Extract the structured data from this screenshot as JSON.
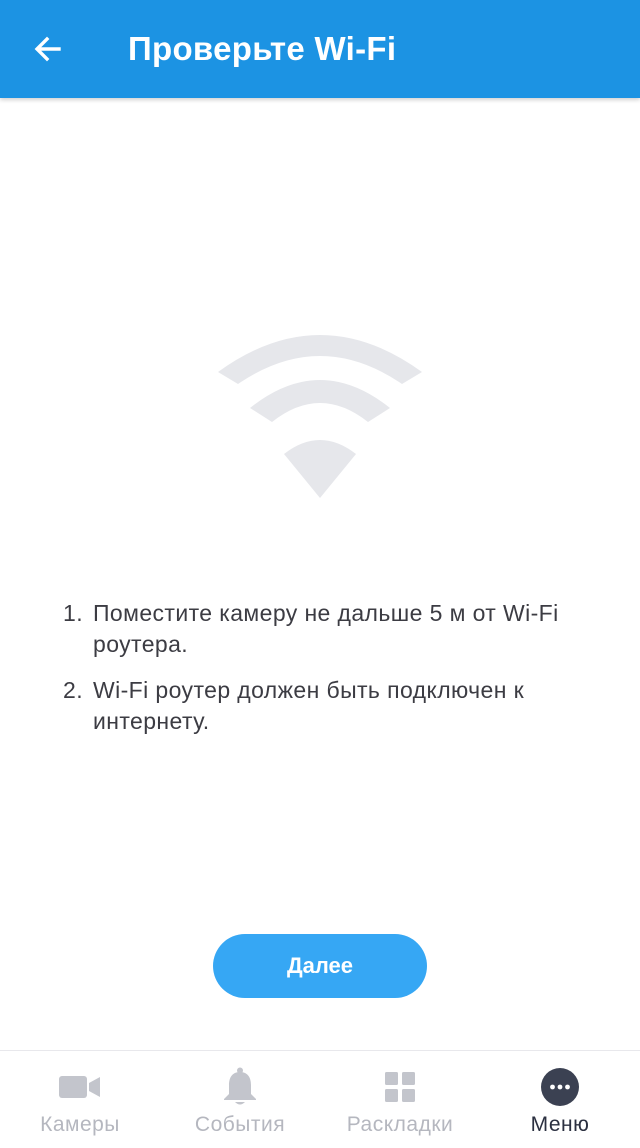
{
  "header": {
    "title": "Проверьте Wi-Fi",
    "back_icon": "arrow-left-icon"
  },
  "illustration": {
    "icon": "wifi-icon",
    "color": "#e6e7eb"
  },
  "instructions": [
    {
      "num": "1.",
      "text": "Поместите камеру не дальше 5 м от Wi-Fi роутера."
    },
    {
      "num": "2.",
      "text": "Wi-Fi роутер должен быть подключен к интернету."
    }
  ],
  "next_button": {
    "label": "Далее"
  },
  "tabbar": {
    "active": "menu",
    "tabs": [
      {
        "id": "cameras",
        "label": "Камеры",
        "icon": "video-camera-icon"
      },
      {
        "id": "events",
        "label": "События",
        "icon": "bell-icon"
      },
      {
        "id": "layouts",
        "label": "Раскладки",
        "icon": "grid-icon"
      },
      {
        "id": "menu",
        "label": "Меню",
        "icon": "more-dots-icon"
      }
    ]
  },
  "colors": {
    "appbar": "#1c93e3",
    "button": "#36a7f4",
    "tab_inactive": "#b5b7bf",
    "tab_active": "#2b3040",
    "text": "#3c3c43"
  }
}
